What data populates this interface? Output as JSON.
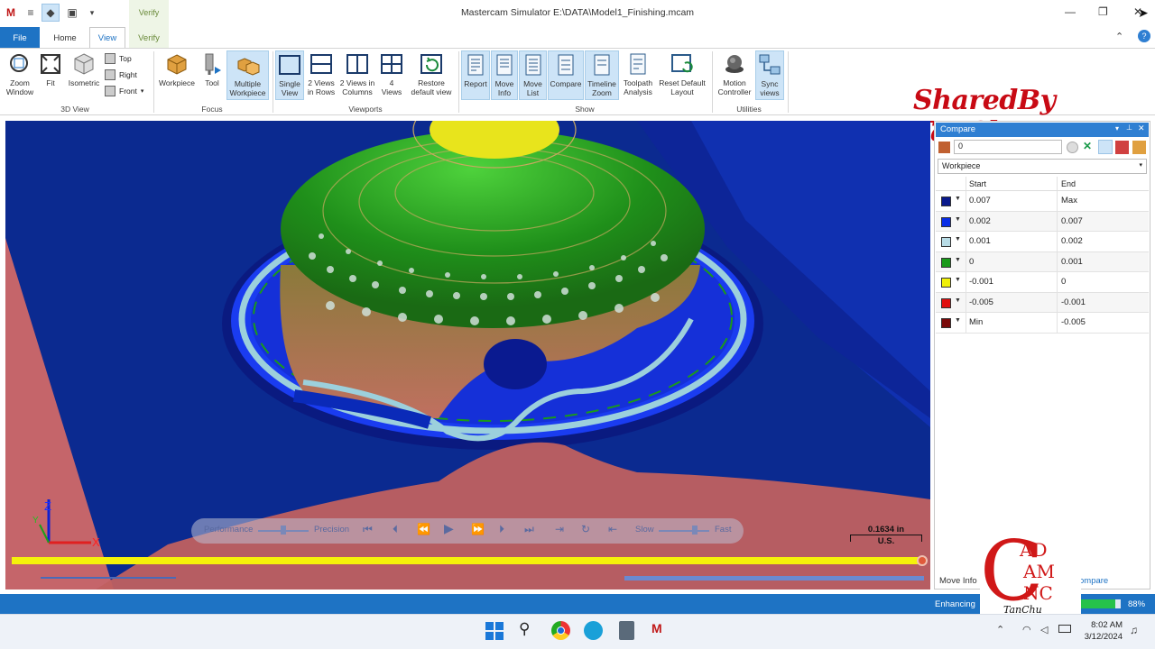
{
  "window": {
    "title": "Mastercam Simulator  E:\\DATA\\Model1_Finishing.mcam"
  },
  "tabs": {
    "file": "File",
    "home": "Home",
    "view": "View",
    "verify": "Verify",
    "verify_context": "Verify"
  },
  "ribbon": {
    "view3d": {
      "zoom": "Zoom Window",
      "fit": "Fit",
      "iso": "Isometric",
      "top": "Top",
      "right": "Right",
      "front": "Front",
      "group": "3D View"
    },
    "focus": {
      "workpiece": "Workpiece",
      "tool": "Tool",
      "multi": "Multiple Workpiece",
      "group": "Focus"
    },
    "viewports": {
      "single": "Single View",
      "rows": "2 Views in Rows",
      "cols": "2 Views in Columns",
      "four": "4 Views",
      "restore": "Restore default view",
      "group": "Viewports"
    },
    "show": {
      "report": "Report",
      "moveinfo": "Move Info",
      "movelist": "Move List",
      "compare": "Compare",
      "timeline": "Timeline Zoom",
      "analysis": "Toolpath Analysis",
      "reset": "Reset Default Layout",
      "group": "Show"
    },
    "utilities": {
      "motion": "Motion Controller",
      "sync": "Sync views",
      "group": "Utilities"
    }
  },
  "watermark": "SharedBy TanChu",
  "compare": {
    "title": "Compare",
    "input_value": "0",
    "target": "Workpiece",
    "col_start": "Start",
    "col_end": "End",
    "rows": [
      {
        "start": "0.007",
        "end": "Max",
        "color": "#0a1a8c"
      },
      {
        "start": "0.002",
        "end": "0.007",
        "color": "#0a2ee6"
      },
      {
        "start": "0.001",
        "end": "0.002",
        "color": "#b8dce6"
      },
      {
        "start": "0",
        "end": "0.001",
        "color": "#1a9a1a"
      },
      {
        "start": "-0.001",
        "end": "0",
        "color": "#f0f00a"
      },
      {
        "start": "-0.005",
        "end": "-0.001",
        "color": "#e01010"
      },
      {
        "start": "Min",
        "end": "-0.005",
        "color": "#7a0a0a"
      }
    ],
    "bottom_tabs": {
      "moveinfo": "Move Info",
      "compare": "ompare"
    }
  },
  "playback": {
    "performance": "Performance",
    "precision": "Precision",
    "slow": "Slow",
    "fast": "Fast"
  },
  "scale": {
    "value": "0.1634 in",
    "unit": "U.S."
  },
  "status": {
    "text": "Enhancing",
    "percent": "88%"
  },
  "logo": {
    "line1": "AD",
    "line2": "AM",
    "line3": "NC",
    "name": "TanChu"
  },
  "taskbar": {
    "time": "8:02 AM",
    "date": "3/12/2024"
  }
}
